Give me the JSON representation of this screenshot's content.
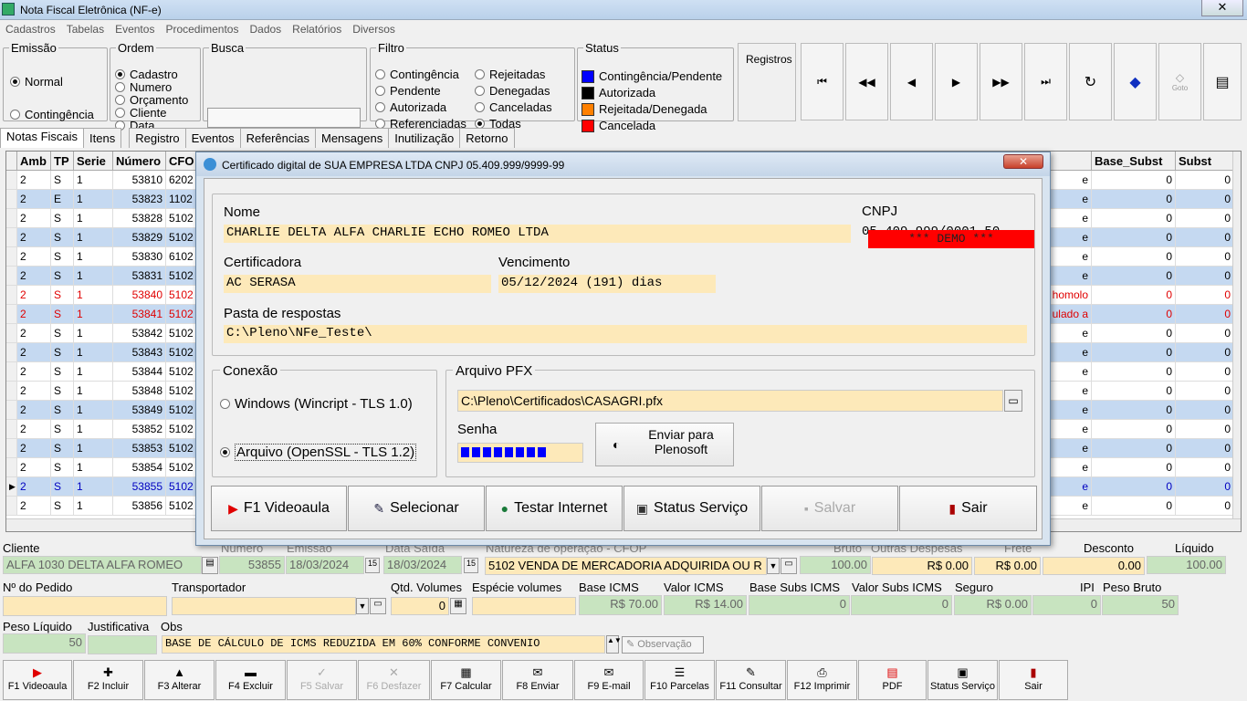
{
  "window": {
    "title": "Nota Fiscal Eletrônica (NF-e)",
    "close": "✕"
  },
  "menu": [
    "Cadastros",
    "Tabelas",
    "Eventos",
    "Procedimentos",
    "Dados",
    "Relatórios",
    "Diversos"
  ],
  "emissao": {
    "legend": "Emissão",
    "opt1": "Normal",
    "opt2": "Contingência"
  },
  "ordem": {
    "legend": "Ordem",
    "opts": [
      "Cadastro",
      "Numero",
      "Orçamento",
      "Cliente",
      "Data"
    ]
  },
  "busca": {
    "legend": "Busca",
    "value": ""
  },
  "filtro": {
    "legend": "Filtro",
    "opts": [
      "Contingência",
      "Pendente",
      "Autorizada",
      "Referenciadas",
      "Rejeitadas",
      "Denegadas",
      "Canceladas",
      "Todas"
    ]
  },
  "status": {
    "legend": "Status",
    "items": [
      {
        "label": "Contingência/Pendente",
        "color": "#0000ff"
      },
      {
        "label": "Autorizada",
        "color": "#000000"
      },
      {
        "label": "Rejeitada/Denegada",
        "color": "#ff8000"
      },
      {
        "label": "Cancelada",
        "color": "#ff0000"
      }
    ]
  },
  "registros": {
    "label": "Registros"
  },
  "nav": {
    "goto": "Goto"
  },
  "tabs": [
    "Notas Fiscais",
    "Itens",
    "Registro",
    "Eventos",
    "Referências",
    "Mensagens",
    "Inutilização",
    "Retorno"
  ],
  "grid": {
    "headers": [
      "Amb",
      "TP",
      "Serie",
      "Número",
      "CFO",
      "Base_Subst",
      "Subst"
    ],
    "rows": [
      {
        "amb": "2",
        "tp": "S",
        "serie": "1",
        "num": "53810",
        "cfo": "6202",
        "tail": "e",
        "bs": "0",
        "st": "0"
      },
      {
        "amb": "2",
        "tp": "E",
        "serie": "1",
        "num": "53823",
        "cfo": "1102",
        "tail": "e",
        "bs": "0",
        "st": "0"
      },
      {
        "amb": "2",
        "tp": "S",
        "serie": "1",
        "num": "53828",
        "cfo": "5102",
        "tail": "e",
        "bs": "0",
        "st": "0"
      },
      {
        "amb": "2",
        "tp": "S",
        "serie": "1",
        "num": "53829",
        "cfo": "5102",
        "tail": "e",
        "bs": "0",
        "st": "0"
      },
      {
        "amb": "2",
        "tp": "S",
        "serie": "1",
        "num": "53830",
        "cfo": "6102",
        "tail": "e",
        "bs": "0",
        "st": "0"
      },
      {
        "amb": "2",
        "tp": "S",
        "serie": "1",
        "num": "53831",
        "cfo": "5102",
        "tail": "e",
        "bs": "0",
        "st": "0"
      },
      {
        "amb": "2",
        "tp": "S",
        "serie": "1",
        "num": "53840",
        "cfo": "5102",
        "tail": "homolo",
        "bs": "0",
        "st": "0"
      },
      {
        "amb": "2",
        "tp": "S",
        "serie": "1",
        "num": "53841",
        "cfo": "5102",
        "tail": "ulado a",
        "bs": "0",
        "st": "0"
      },
      {
        "amb": "2",
        "tp": "S",
        "serie": "1",
        "num": "53842",
        "cfo": "5102",
        "tail": "e",
        "bs": "0",
        "st": "0"
      },
      {
        "amb": "2",
        "tp": "S",
        "serie": "1",
        "num": "53843",
        "cfo": "5102",
        "tail": "e",
        "bs": "0",
        "st": "0"
      },
      {
        "amb": "2",
        "tp": "S",
        "serie": "1",
        "num": "53844",
        "cfo": "5102",
        "tail": "e",
        "bs": "0",
        "st": "0"
      },
      {
        "amb": "2",
        "tp": "S",
        "serie": "1",
        "num": "53848",
        "cfo": "5102",
        "tail": "e",
        "bs": "0",
        "st": "0"
      },
      {
        "amb": "2",
        "tp": "S",
        "serie": "1",
        "num": "53849",
        "cfo": "5102",
        "tail": "e",
        "bs": "0",
        "st": "0"
      },
      {
        "amb": "2",
        "tp": "S",
        "serie": "1",
        "num": "53852",
        "cfo": "5102",
        "tail": "e",
        "bs": "0",
        "st": "0"
      },
      {
        "amb": "2",
        "tp": "S",
        "serie": "1",
        "num": "53853",
        "cfo": "5102",
        "tail": "e",
        "bs": "0",
        "st": "0"
      },
      {
        "amb": "2",
        "tp": "S",
        "serie": "1",
        "num": "53854",
        "cfo": "5102",
        "tail": "e",
        "bs": "0",
        "st": "0"
      },
      {
        "amb": "2",
        "tp": "S",
        "serie": "1",
        "num": "53855",
        "cfo": "5102",
        "tail": "e",
        "bs": "0",
        "st": "0"
      },
      {
        "amb": "2",
        "tp": "S",
        "serie": "1",
        "num": "53856",
        "cfo": "5102",
        "tail": "e",
        "bs": "0",
        "st": "0"
      }
    ]
  },
  "form": {
    "cliente_label": "Cliente",
    "cliente": "ALFA 1030 DELTA ALFA ROMEO",
    "numero_label": "Número",
    "numero": "53855",
    "emissao_label": "Emissão",
    "emissao": "18/03/2024",
    "data_saida_label": "Data Saída",
    "data_saida": "18/03/2024",
    "natureza_label": "Natureza de operação - CFOP",
    "natureza": "5102 VENDA DE MERCADORIA ADQUIRIDA OU R",
    "bruto_label": "Bruto",
    "bruto": "100.00",
    "outras_label": "Outras Despesas",
    "outras": "R$ 0.00",
    "frete_label": "Frete",
    "frete": "R$ 0.00",
    "desconto_label": "Desconto",
    "desconto": "0.00",
    "liquido_label": "Líquido",
    "liquido": "100.00",
    "pedido_label": "Nº do Pedido",
    "transportador_label": "Transportador",
    "qtd_label": "Qtd. Volumes",
    "qtd": "0",
    "especie_label": "Espécie volumes",
    "base_icms_label": "Base ICMS",
    "base_icms": "R$ 70.00",
    "valor_icms_label": "Valor ICMS",
    "valor_icms": "R$ 14.00",
    "base_subs_label": "Base Subs ICMS",
    "base_subs": "0",
    "valor_subs_label": "Valor Subs ICMS",
    "valor_subs": "0",
    "seguro_label": "Seguro",
    "seguro": "R$ 0.00",
    "ipi_label": "IPI",
    "ipi": "0",
    "peso_bruto_label": "Peso Bruto",
    "peso_bruto": "50",
    "peso_liq_label": "Peso Líquido",
    "peso_liq": "50",
    "justif_label": "Justificativa",
    "obs_label": "Obs",
    "obs": "BASE DE CÁLCULO DE ICMS REDUZIDA EM  60%  CONFORME  CONVENIO",
    "observacao_btn": "Observação"
  },
  "toolbar": [
    {
      "label": "F1 Videoaula",
      "icon": "▶",
      "color": "#e00000",
      "enabled": true
    },
    {
      "label": "F2 Incluir",
      "icon": "✚",
      "color": "#000",
      "enabled": true
    },
    {
      "label": "F3 Alterar",
      "icon": "▲",
      "color": "#000",
      "enabled": true
    },
    {
      "label": "F4 Excluir",
      "icon": "▬",
      "color": "#000",
      "enabled": true
    },
    {
      "label": "F5 Salvar",
      "icon": "✓",
      "color": "#aaa",
      "enabled": false
    },
    {
      "label": "F6 Desfazer",
      "icon": "✕",
      "color": "#aaa",
      "enabled": false
    },
    {
      "label": "F7 Calcular",
      "icon": "▦",
      "color": "#000",
      "enabled": true
    },
    {
      "label": "F8 Enviar",
      "icon": "✉",
      "color": "#000",
      "enabled": true
    },
    {
      "label": "F9 E-mail",
      "icon": "✉",
      "color": "#000",
      "enabled": true
    },
    {
      "label": "F10 Parcelas",
      "icon": "☰",
      "color": "#000",
      "enabled": true
    },
    {
      "label": "F11 Consultar",
      "icon": "✎",
      "color": "#000",
      "enabled": true
    },
    {
      "label": "F12 Imprimir",
      "icon": "⎙",
      "color": "#000",
      "enabled": true
    },
    {
      "label": "PDF",
      "icon": "▤",
      "color": "#d00",
      "enabled": true
    },
    {
      "label": "Status Serviço",
      "icon": "▣",
      "color": "#000",
      "enabled": true
    },
    {
      "label": "Sair",
      "icon": "▮",
      "color": "#a00",
      "enabled": true
    }
  ],
  "dialog": {
    "title": "Certificado digital de SUA EMPRESA LTDA CNPJ 05.409.999/9999-99",
    "close": "✕",
    "nome_label": "Nome",
    "nome": "CHARLIE DELTA ALFA CHARLIE ECHO ROMEO LTDA",
    "cnpj_label": "CNPJ",
    "cnpj": "05.409.999/0001-50",
    "demo": "*** DEMO ***",
    "certificadora_label": "Certificadora",
    "certificadora": "AC SERASA",
    "vencimento_label": "Vencimento",
    "vencimento": "05/12/2024 (191) dias",
    "pasta_label": "Pasta de respostas",
    "pasta": "C:\\Pleno\\NFe_Teste\\",
    "conexao_legend": "Conexão",
    "conexao_opt1": "Windows (Wincript - TLS 1.0)",
    "conexao_opt2": "Arquivo  (OpenSSL - TLS 1.2)",
    "pfx_legend": "Arquivo PFX",
    "pfx_path": "C:\\Pleno\\Certificados\\CASAGRI.pfx",
    "senha_label": "Senha",
    "enviar_label": "Enviar para Plenosoft",
    "buttons": [
      {
        "label": "F1 Videoaula",
        "icon": "▶",
        "color": "#e00000",
        "enabled": true
      },
      {
        "label": "Selecionar",
        "icon": "✎",
        "color": "#224",
        "enabled": true
      },
      {
        "label": "Testar Internet",
        "icon": "●",
        "color": "#1a7a3a",
        "enabled": true
      },
      {
        "label": "Status Serviço",
        "icon": "▣",
        "color": "#333",
        "enabled": true
      },
      {
        "label": "Salvar",
        "icon": "▪",
        "color": "#aaa",
        "enabled": false
      },
      {
        "label": "Sair",
        "icon": "▮",
        "color": "#a00",
        "enabled": true
      }
    ]
  }
}
